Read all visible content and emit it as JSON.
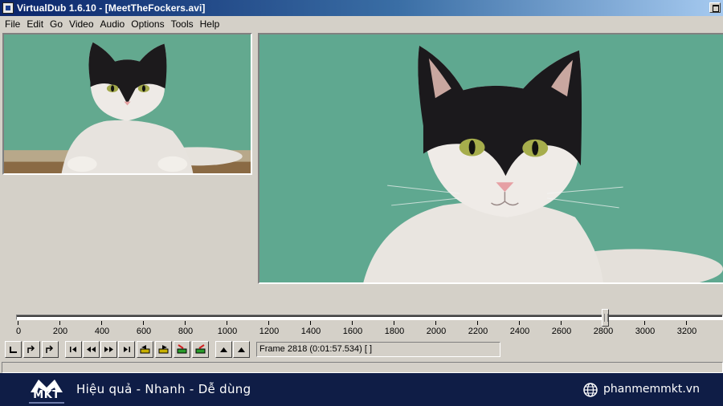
{
  "window": {
    "title": "VirtualDub 1.6.10 - [MeetTheFockers.avi]"
  },
  "menu": {
    "items": [
      "File",
      "Edit",
      "Go",
      "Video",
      "Audio",
      "Options",
      "Tools",
      "Help"
    ]
  },
  "panes": {
    "input": {
      "content": "cat video frame"
    },
    "output": {
      "content": "cat video frame"
    }
  },
  "timeline": {
    "ticks": [
      "0",
      "200",
      "400",
      "600",
      "800",
      "1000",
      "1200",
      "1400",
      "1600",
      "1800",
      "2000",
      "2200",
      "2400",
      "2600",
      "2800",
      "3000",
      "3200"
    ],
    "current_frame": 2818
  },
  "toolbar": {
    "buttons": [
      "stop-icon",
      "play-input-icon",
      "play-output-icon",
      "start-icon",
      "prev-icon",
      "next-icon",
      "end-icon",
      "prev-key-icon",
      "next-key-icon",
      "scene-rev-icon",
      "scene-fwd-icon",
      "mark-in-icon",
      "mark-out-icon"
    ],
    "frame_status": "Frame 2818 (0:01:57.534) [ ]"
  },
  "footer": {
    "logo": "MKT",
    "slogan": "Hiệu quả - Nhanh  - Dễ dùng",
    "website": "phanmemmkt.vn"
  },
  "colors": {
    "titlebar_start": "#0a246a",
    "titlebar_end": "#a6caf0",
    "window_face": "#d4d0c8",
    "footer_bg": "#0f1d46",
    "frame_background": "#5fa890"
  }
}
